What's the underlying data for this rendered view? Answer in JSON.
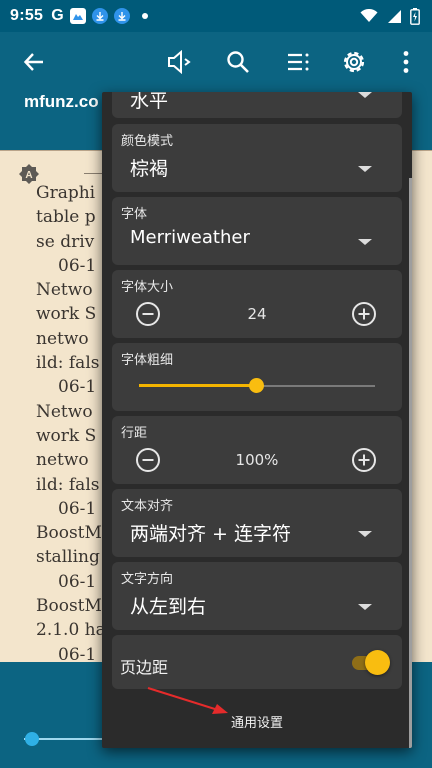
{
  "status": {
    "time": "9:55",
    "g_letter": "G"
  },
  "toolbar": {
    "subtitle": "mfunz.co"
  },
  "reader": {
    "lines": [
      {
        "t": "Graphi",
        "indent": false
      },
      {
        "t": "table p",
        "indent": false
      },
      {
        "t": "se driv",
        "indent": false
      },
      {
        "t": "06-1",
        "indent": true
      },
      {
        "t": "Netwo",
        "indent": false
      },
      {
        "t": "work S",
        "indent": false
      },
      {
        "t": "netwo",
        "indent": false
      },
      {
        "t": "ild: fals",
        "indent": false
      },
      {
        "t": "06-1",
        "indent": true
      },
      {
        "t": "Netwo",
        "indent": false
      },
      {
        "t": "work S",
        "indent": false
      },
      {
        "t": "netwo",
        "indent": false
      },
      {
        "t": "ild: fals",
        "indent": false
      },
      {
        "t": "06-1",
        "indent": true
      },
      {
        "t": "BoostM",
        "indent": false
      },
      {
        "t": "stalling",
        "indent": false
      },
      {
        "t": "06-1",
        "indent": true
      },
      {
        "t": "BoostM",
        "indent": false
      },
      {
        "t": "2.1.0 ha",
        "indent": false
      },
      {
        "t": "06-1",
        "indent": true
      },
      {
        "t": "BoostM",
        "indent": false
      }
    ],
    "progress": 0.02
  },
  "panel": {
    "partial_value": "水平",
    "color_mode": {
      "label": "颜色模式",
      "value": "棕褐"
    },
    "font": {
      "label": "字体",
      "value": "Merriweather"
    },
    "font_size": {
      "label": "字体大小",
      "value": "24"
    },
    "font_weight": {
      "label": "字体粗细",
      "level": 0.5
    },
    "line_spacing": {
      "label": "行距",
      "value": "100%"
    },
    "text_align": {
      "label": "文本对齐",
      "value": "两端对齐 + 连字符"
    },
    "text_direction": {
      "label": "文字方向",
      "value": "从左到右"
    },
    "margins": {
      "label": "页边距",
      "enabled": true
    },
    "general_settings": "通用设置"
  },
  "colors": {
    "toolbar": "#0c6482",
    "page": "#f3e5cc",
    "accent": "#f9bd10",
    "panel": "#2b2b2b",
    "card": "#3c3c3c"
  }
}
